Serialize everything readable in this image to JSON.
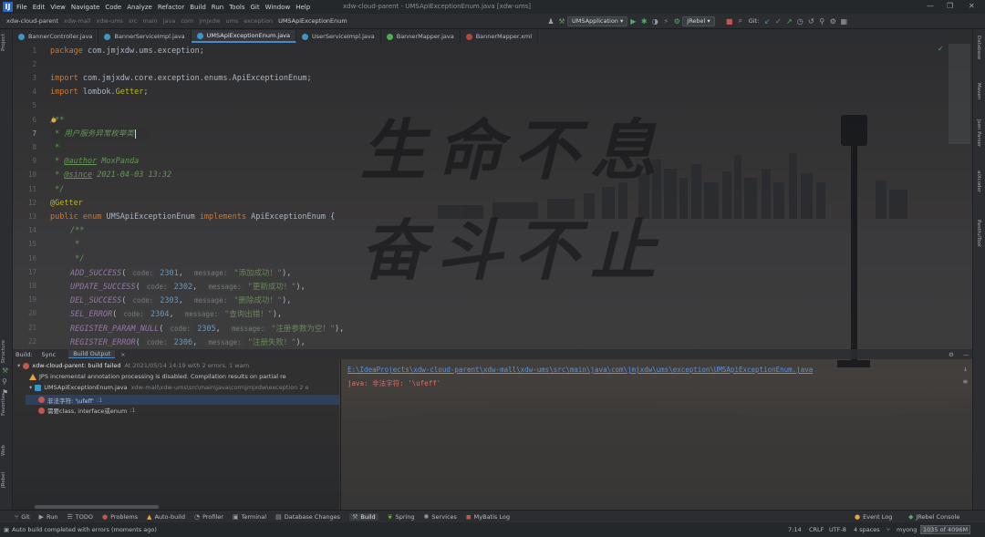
{
  "menubar": {
    "items": [
      "File",
      "Edit",
      "View",
      "Navigate",
      "Code",
      "Analyze",
      "Refactor",
      "Build",
      "Run",
      "Tools",
      "Git",
      "Window",
      "Help"
    ],
    "window_title": "xdw-cloud-parent - UMSApiExceptionEnum.java [xdw-ums]"
  },
  "navbar": {
    "crumbs": [
      "xdw-cloud-parent",
      "xdw-mall",
      "xdw-ums",
      "src",
      "main",
      "java",
      "com",
      "jmjxdw",
      "ums",
      "exception",
      "UMSApiExceptionEnum"
    ],
    "run_config": "UMSApplication",
    "jrebel": "JRebel",
    "git_label": "Git:"
  },
  "tabs": [
    {
      "label": "BannerController.java",
      "color": "#3c97c6"
    },
    {
      "label": "BannerServiceImpl.java",
      "color": "#3c97c6"
    },
    {
      "label": "UMSApiExceptionEnum.java",
      "color": "#3c97c6",
      "active": true
    },
    {
      "label": "UserServiceImpl.java",
      "color": "#3c97c6"
    },
    {
      "label": "BannerMapper.java",
      "color": "#4caf50"
    },
    {
      "label": "BannerMapper.xml",
      "color": "#b5463e"
    }
  ],
  "left_tools": {
    "project": "Project",
    "structure": "Structure",
    "favorites": "Favorites",
    "web": "Web",
    "jrebel": "JRebel"
  },
  "right_tools": {
    "database": "Database",
    "maven": "Maven",
    "json_parser": "Json Parser",
    "aixcoder": "aiXcoder",
    "restful": "RestfulTool"
  },
  "editor": {
    "line_numbers": [
      "1",
      "2",
      "3",
      "4",
      "5",
      "6",
      "7",
      "8",
      "9",
      "10",
      "11",
      "12",
      "13",
      "14",
      "15",
      "16",
      "17",
      "18",
      "19",
      "20",
      "21",
      "22"
    ],
    "package_kw": "package",
    "package_name": "com.jmjxdw.ums.exception;",
    "import_kw": "import",
    "import1": "com.jmjxdw.core.exception.enums.ApiExceptionEnum;",
    "import2_pkg": "lombok.",
    "import2_cls": "Getter",
    "import2_end": ";",
    "doc_open": "/**",
    "doc_desc": " * 用户服务异常枚举类",
    "doc_star": " *",
    "author_tag": "@author",
    "author_val": " MoxPanda",
    "since_tag": "@since",
    "since_val": " 2021-04-03 13:32",
    "doc_close": " */",
    "annotation": "@Getter",
    "decl_public": "public",
    "decl_enum": "enum",
    "decl_name": "UMSApiExceptionEnum",
    "decl_implements": "implements",
    "decl_iface": "ApiExceptionEnum",
    "decl_brace": " {",
    "inner_doc_open": "/**",
    "inner_doc_star": " *",
    "inner_doc_close": " */",
    "hint_code": "code:",
    "hint_message": "message:",
    "enum_rows": [
      {
        "name": "ADD_SUCCESS",
        "code": "2301",
        "msg": "\"添加成功！\""
      },
      {
        "name": "UPDATE_SUCCESS",
        "code": "2302",
        "msg": "\"更新成功！\""
      },
      {
        "name": "DEL_SUCCESS",
        "code": "2303",
        "msg": "\"删除成功！\""
      },
      {
        "name": "SEL_ERROR",
        "code": "2304",
        "msg": "\"查询出错！\""
      },
      {
        "name": "REGISTER_PARAM_NULL",
        "code": "2305",
        "msg": "\"注册参数为空！\""
      },
      {
        "name": "REGISTER_ERROR",
        "code": "2306",
        "msg": "\"注册失败！\""
      }
    ]
  },
  "background_text": {
    "line1": "生命不息",
    "line2": "奋斗不止"
  },
  "build": {
    "header_label": "Build:",
    "tab_sync": "Sync",
    "tab_output": "Build Output",
    "root": "xdw-cloud-parent: build failed",
    "root_time": "At 2021/05/14 14:19 with 2 errors, 1 warn",
    "warning": "JPS incremental annotation processing is disabled. Compilation results on partial re",
    "file": "UMSApiExceptionEnum.java",
    "file_path": "xdw-mall\\xdw-ums\\src\\main\\java\\com\\jmjxdw\\exception 2 e",
    "error1": "非法字符: '\\ufeff'",
    "error1_loc": ":1",
    "error2": "需要class, interface或enum",
    "error2_loc": ":1",
    "out_path": "E:\\IdeaProjects\\xdw-cloud-parent\\xdw-mall\\xdw-ums\\src\\main\\java\\com\\jmjxdw\\ums\\exception\\UMSApiExceptionEnum.java",
    "out_error": "java: 非法字符: '\\ufeff'"
  },
  "bottom_tabs": [
    "Git",
    "Run",
    "TODO",
    "Problems",
    "Auto-build",
    "Profiler",
    "Terminal",
    "Database Changes",
    "Build",
    "Spring",
    "Services",
    "MyBatis Log"
  ],
  "bottom_right": [
    "Event Log",
    "JRebel Console"
  ],
  "status": {
    "message": "Auto build completed with errors (moments ago)",
    "position": "7:14",
    "line_sep": "CRLF",
    "encoding": "UTF-8",
    "indent": "4 spaces",
    "user": "myong",
    "memory": "1035 of 4096M"
  }
}
